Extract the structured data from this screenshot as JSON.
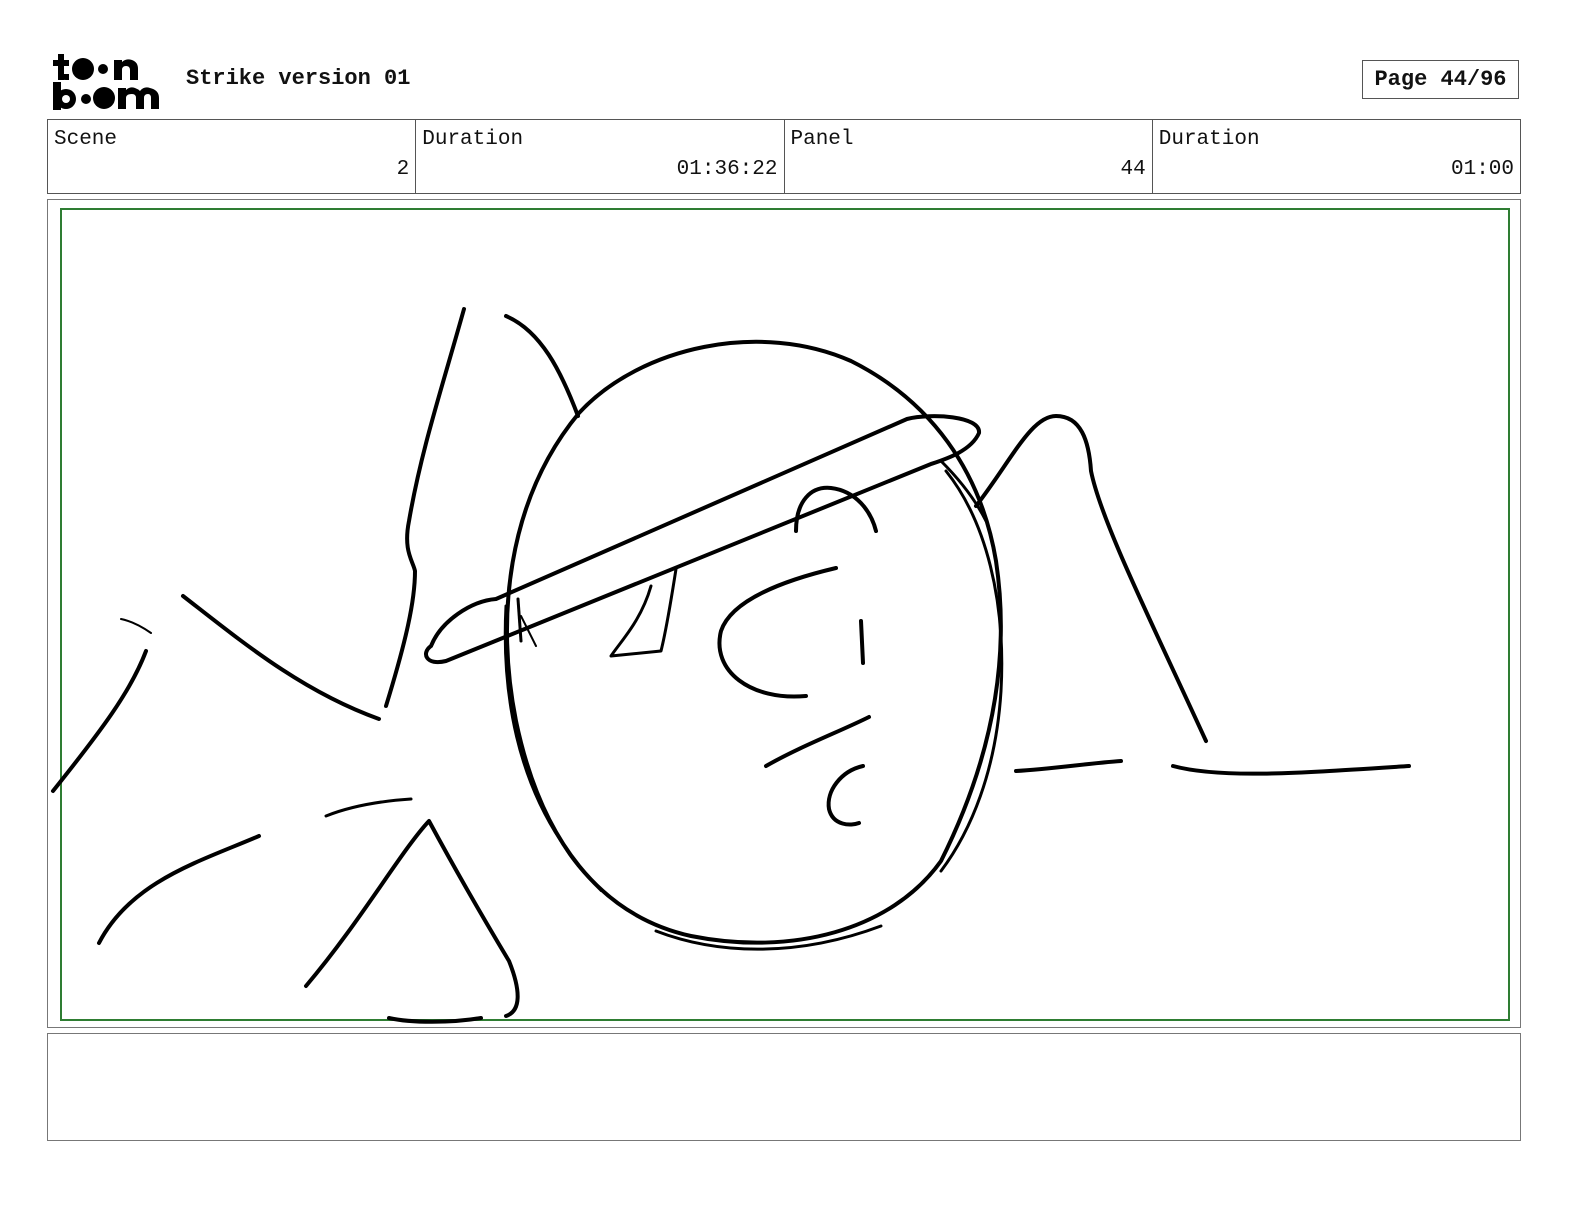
{
  "header": {
    "logo_top": "toon",
    "logo_bottom": "boom",
    "title": "Strike version 01",
    "page_label": "Page 44/96"
  },
  "info": [
    {
      "label": "Scene",
      "value": "2"
    },
    {
      "label": "Duration",
      "value": "01:36:22"
    },
    {
      "label": "Panel",
      "value": "44"
    },
    {
      "label": "Duration",
      "value": "01:00"
    }
  ],
  "panel": {
    "frame_color": "#2e7d32",
    "sketch_color": "#000000"
  },
  "notes": {
    "text": ""
  }
}
